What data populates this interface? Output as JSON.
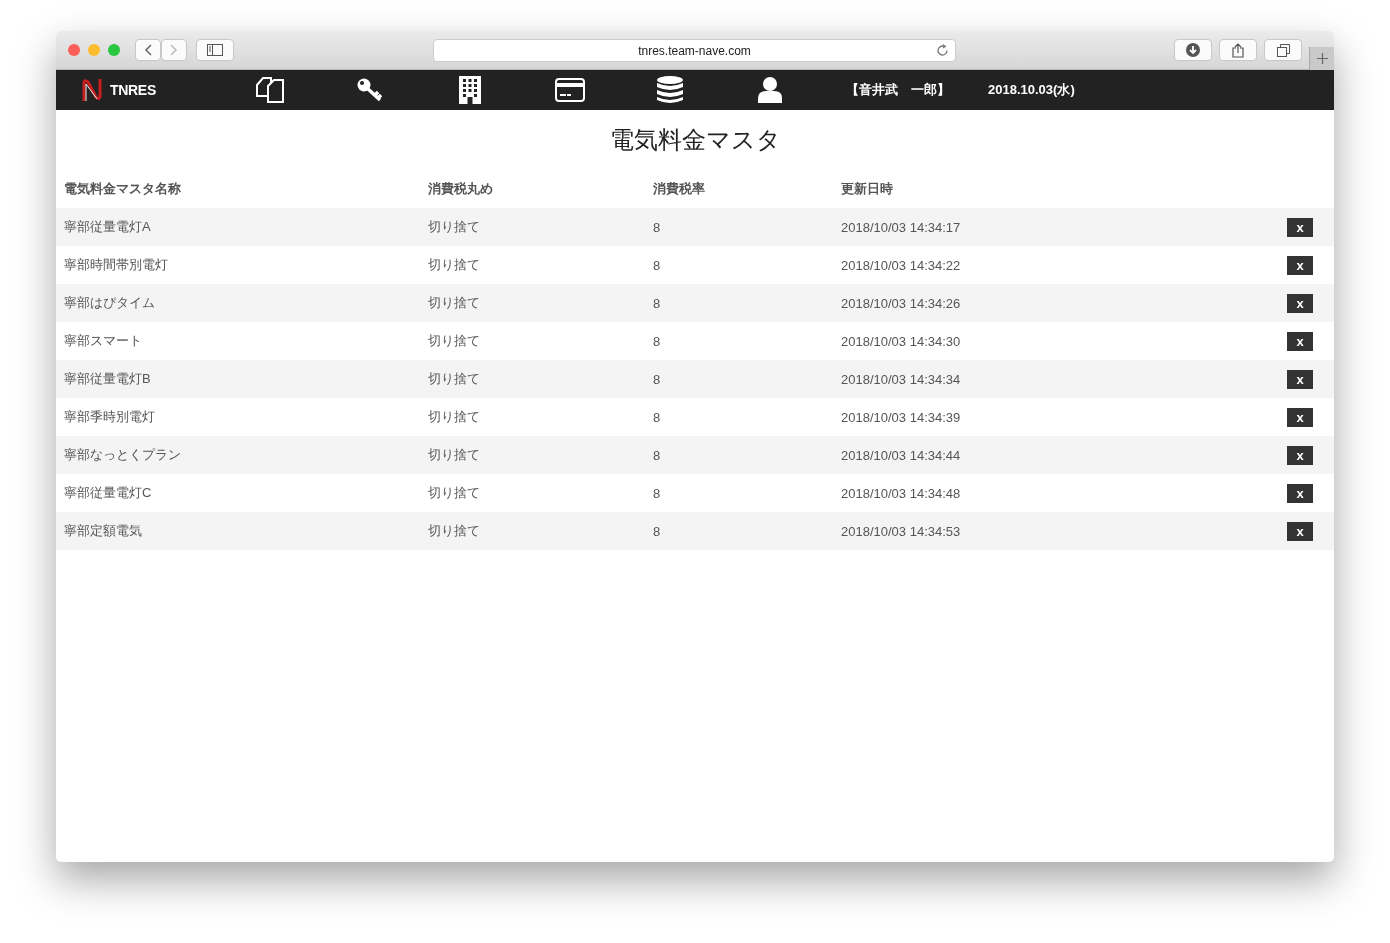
{
  "browser": {
    "url": "tnres.team-nave.com"
  },
  "nav": {
    "brand": "TNRES",
    "user": "【音井武　一郎】",
    "date": "2018.10.03(水)"
  },
  "page_title": "電気料金マスタ",
  "table": {
    "columns": [
      "電気料金マスタ名称",
      "消費税丸め",
      "消費税率",
      "更新日時"
    ],
    "rows": [
      {
        "name": "寧部従量電灯A",
        "rounding": "切り捨て",
        "rate": "8",
        "updated": "2018/10/03 14:34:17",
        "delete": "x"
      },
      {
        "name": "寧部時間帯別電灯",
        "rounding": "切り捨て",
        "rate": "8",
        "updated": "2018/10/03 14:34:22",
        "delete": "x"
      },
      {
        "name": "寧部はぴタイム",
        "rounding": "切り捨て",
        "rate": "8",
        "updated": "2018/10/03 14:34:26",
        "delete": "x"
      },
      {
        "name": "寧部スマート",
        "rounding": "切り捨て",
        "rate": "8",
        "updated": "2018/10/03 14:34:30",
        "delete": "x"
      },
      {
        "name": "寧部従量電灯B",
        "rounding": "切り捨て",
        "rate": "8",
        "updated": "2018/10/03 14:34:34",
        "delete": "x"
      },
      {
        "name": "寧部季時別電灯",
        "rounding": "切り捨て",
        "rate": "8",
        "updated": "2018/10/03 14:34:39",
        "delete": "x"
      },
      {
        "name": "寧部なっとくプラン",
        "rounding": "切り捨て",
        "rate": "8",
        "updated": "2018/10/03 14:34:44",
        "delete": "x"
      },
      {
        "name": "寧部従量電灯C",
        "rounding": "切り捨て",
        "rate": "8",
        "updated": "2018/10/03 14:34:48",
        "delete": "x"
      },
      {
        "name": "寧部定額電気",
        "rounding": "切り捨て",
        "rate": "8",
        "updated": "2018/10/03 14:34:53",
        "delete": "x"
      }
    ]
  }
}
